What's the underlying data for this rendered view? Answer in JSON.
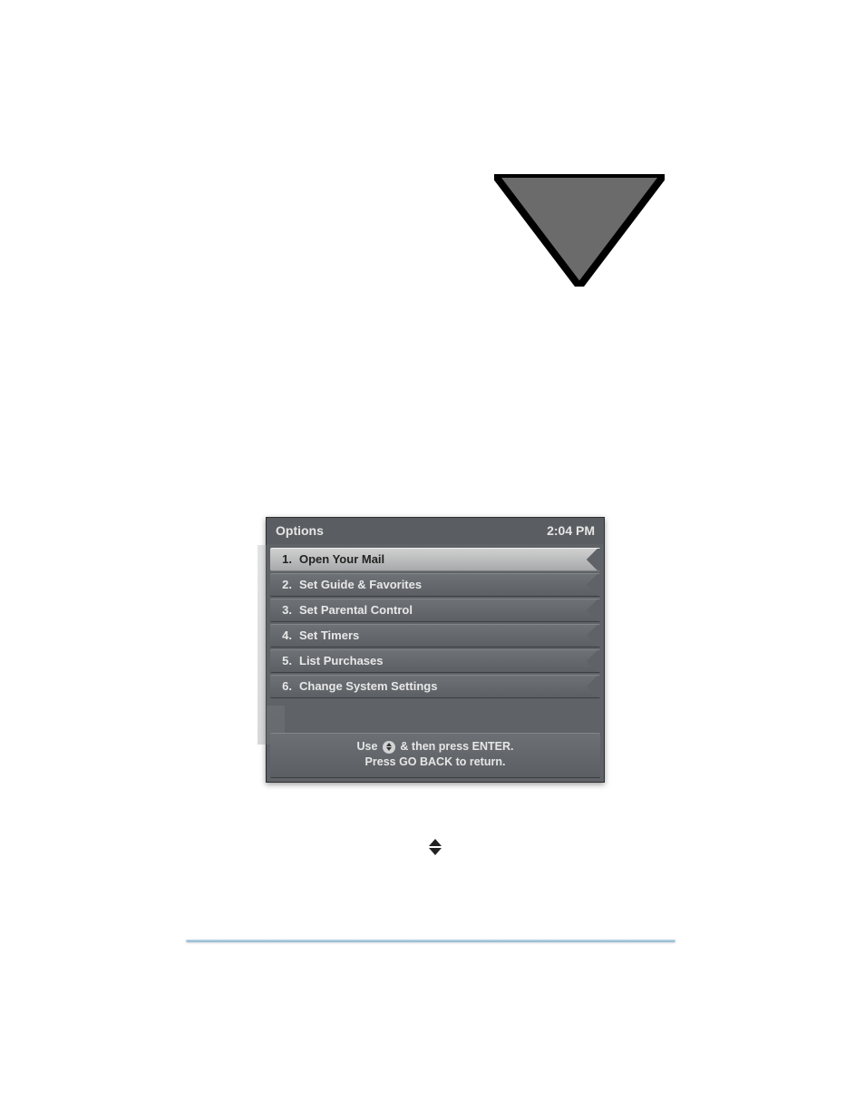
{
  "panel": {
    "title": "Options",
    "time": "2:04 PM",
    "items": [
      {
        "num": "1.",
        "label": "Open Your Mail",
        "selected": true
      },
      {
        "num": "2.",
        "label": "Set Guide & Favorites",
        "selected": false
      },
      {
        "num": "3.",
        "label": "Set Parental Control",
        "selected": false
      },
      {
        "num": "4.",
        "label": "Set Timers",
        "selected": false
      },
      {
        "num": "5.",
        "label": "List Purchases",
        "selected": false
      },
      {
        "num": "6.",
        "label": "Change System Settings",
        "selected": false
      }
    ],
    "hint_line1_pre": "Use ",
    "hint_line1_post": " & then press ENTER.",
    "hint_line2": "Press GO BACK to return."
  }
}
